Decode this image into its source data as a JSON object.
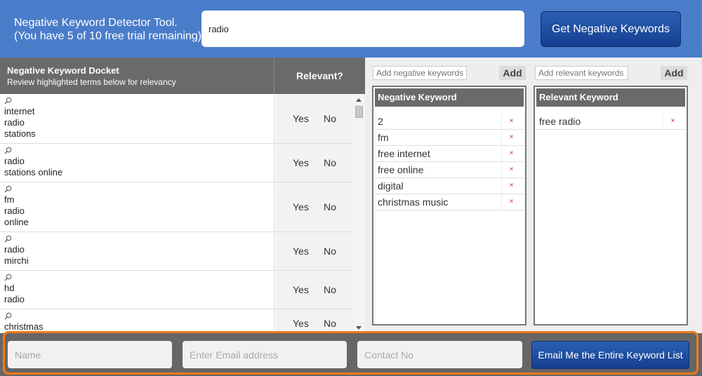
{
  "header": {
    "title_line1": "Negative Keyword Detector Tool.",
    "title_line2": "(You have 5 of 10 free trial remaining)",
    "search_value": "radio",
    "get_button": "Get Negative Keywords"
  },
  "docket": {
    "title": "Negative Keyword Docket",
    "subtitle": "Review highlighted terms below for relevancy",
    "relevant_header": "Relevant?",
    "yes_label": "Yes",
    "no_label": "No",
    "rows": [
      {
        "lines": [
          "internet",
          "radio",
          "stations"
        ]
      },
      {
        "lines": [
          "radio",
          "stations online"
        ]
      },
      {
        "lines": [
          "fm",
          "radio",
          "online"
        ]
      },
      {
        "lines": [
          "radio",
          "mirchi"
        ]
      },
      {
        "lines": [
          "hd",
          "radio"
        ]
      },
      {
        "lines": [
          "christmas"
        ]
      }
    ]
  },
  "negative_panel": {
    "placeholder": "Add negative keywords",
    "add_label": "Add",
    "header": "Negative Keyword",
    "remove_symbol": "×",
    "items": [
      "2",
      "fm",
      "free internet",
      "free online",
      "digital",
      "christmas music"
    ]
  },
  "relevant_panel": {
    "placeholder": "Add relevant keywords",
    "add_label": "Add",
    "header": "Relevant Keyword",
    "remove_symbol": "×",
    "items": [
      "free radio"
    ]
  },
  "footer": {
    "name_placeholder": "Name",
    "email_placeholder": "Enter Email address",
    "contact_placeholder": "Contact No",
    "email_button": "Email Me the Entire Keyword List"
  },
  "colors": {
    "header_bg": "#4a7dc9",
    "button_blue": "#1e4fa0",
    "panel_gray": "#6a6a6a",
    "footer_outline": "#ef7a1a",
    "remove_red": "#cc2222"
  }
}
